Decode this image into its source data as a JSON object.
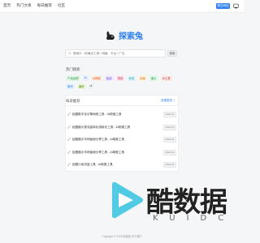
{
  "nav": {
    "items": [
      "首页",
      "热门文章",
      "每日推荐",
      "社区"
    ],
    "submit_label": "提交网址"
  },
  "logo": {
    "text": "探索兔"
  },
  "search": {
    "placeholder": "搜索中（你最近工具 / 网格、平台 / 广告",
    "button_label": "搜索"
  },
  "hot": {
    "title": "热门搜索",
    "tags": [
      {
        "label": "产品经理",
        "color": "#2f9e44",
        "bg": "#e7f6ea"
      },
      {
        "label": "AI",
        "color": "#2f80ed",
        "bg": "#e8f1fd"
      },
      {
        "label": "AI视频",
        "color": "#e8590c",
        "bg": "#fdf0e6"
      },
      {
        "label": "免费",
        "color": "#7048e8",
        "bg": "#efeafd"
      },
      {
        "label": "视频",
        "color": "#d6336c",
        "bg": "#fce9f0"
      },
      {
        "label": "在线",
        "color": "#1098ad",
        "bg": "#e6f6f9"
      },
      {
        "label": "阅读",
        "color": "#e67700",
        "bg": "#fdf3e3"
      },
      {
        "label": "图片",
        "color": "#2f9e44",
        "bg": "#e7f6ea"
      },
      {
        "label": "AI工具",
        "color": "#c92a2a",
        "bg": "#fdeaea"
      },
      {
        "label": "素材",
        "color": "#2f80ed",
        "bg": "#e8f1fd"
      },
      {
        "label": "编程",
        "color": "#5c940d",
        "bg": "#eef6e2"
      },
      {
        "label": "ui",
        "color": "#495057",
        "bg": "#eef0f2"
      }
    ]
  },
  "daily": {
    "title": "每日推荐",
    "more_label": "查看更多 >",
    "items": [
      {
        "text": "拾戳数字化引擎网络工具 - AI助推工具",
        "time": "2024-01"
      },
      {
        "text": "拾戳展示类流量转化用转化工具 - AI助推工具",
        "time": "2024-01"
      },
      {
        "text": "拾戳展示市场营销分享工具 - AI助推工具",
        "time": "2024-01"
      },
      {
        "text": "拾戳展示市场营销分享工具 - AI助推工具",
        "time": "2024-01"
      },
      {
        "text": "拾戳沙用流量工具 - AI助推工具",
        "time": "2024-01"
      }
    ]
  },
  "watermark": {
    "text": "酷数据",
    "sub": "KUIDC"
  },
  "footer": {
    "text": "Copyright © 2023 探索兔  关于我们"
  },
  "colors": {
    "accent": "#2f80ed",
    "background": "#f5f6f8"
  }
}
